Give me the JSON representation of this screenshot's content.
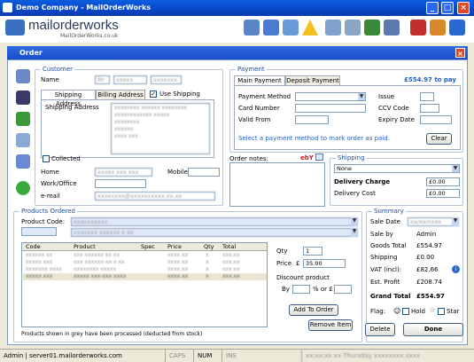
{
  "window": {
    "title": "Demo Company - MailOrderWorks"
  },
  "logo": {
    "name": "mailorderworks",
    "url": "MailOrderWorks.co.uk"
  },
  "dialog": {
    "title": "Order",
    "close": "×"
  },
  "customer": {
    "group": "Customer",
    "name_label": "Name",
    "name_title": "Mr",
    "name_first": "xxxxx",
    "name_last": "xxxxxxx",
    "tabs": [
      "Shipping Address",
      "Billing Address"
    ],
    "use_shipping": "Use Shipping",
    "shipping_label": "Shipping Address",
    "address_lines": [
      "xxxxxxxx xxxxxx xxxxxxxx",
      "xxxxxxxxxxxx xxxxx",
      "xxxxxxxx",
      "xxxxxx",
      "xxxx xxx"
    ],
    "collected": "Collected",
    "home_label": "Home",
    "home_value": "xxxxx xxx xxx",
    "mobile_label": "Mobile",
    "work_label": "Work/Office",
    "email_label": "e-mail",
    "email_value": "xxxxxxxx@xxxxxxxxxx.xx.xx"
  },
  "payment": {
    "group": "Payment",
    "tabs": [
      "Main Payment",
      "Deposit Payment"
    ],
    "amount_due": "£554.97 to pay",
    "method_label": "Payment Method",
    "card_label": "Card Number",
    "valid_label": "Valid From",
    "issue_label": "Issue",
    "ccv_label": "CCV Code",
    "expiry_label": "Expiry Date",
    "hint": "Select a payment method to mark order as paid.",
    "clear": "Clear"
  },
  "notes": {
    "label": "Order notes:",
    "ebay": "ebY"
  },
  "shipping": {
    "group": "Shipping",
    "method": "None",
    "charge_label": "Delivery Charge",
    "charge_value": "£0.00",
    "cost_label": "Delivery Cost",
    "cost_value": "£0.00"
  },
  "products": {
    "group": "Products Ordered",
    "code_label": "Product Code:",
    "search_value": "xxxxxxxxxx",
    "selected_value": "xxxxxxx xxxxxx x xx",
    "columns": [
      "Code",
      "Product",
      "Spec",
      "Price",
      "Qty",
      "Total"
    ],
    "rows": [
      [
        "xxxxxx xx",
        "xxx xxxxxx xx xx",
        "",
        "xxxx.xx",
        "x",
        "xxx.xx"
      ],
      [
        "xxxxx xxx",
        "xxx xxxxxx-xx x xx",
        "",
        "xxxx.xx",
        "x",
        "xxx.xx"
      ],
      [
        "xxxxxxx xxxx",
        "xxxxxxxx xxxxx",
        "",
        "xxxx.xx",
        "x",
        "xxx.xx"
      ],
      [
        "xxxxx xxx",
        "xxxxx xxx-xxx xxxx",
        "",
        "xxxx.xx",
        "x",
        "xxx.xx"
      ]
    ],
    "qty_label": "Qty",
    "qty_value": "1",
    "price_label": "Price",
    "currency": "£",
    "price_value": "35.00",
    "discount_label": "Discount product",
    "by_label": "By",
    "percent_or": "% or £",
    "add_button": "Add To Order",
    "remove_button": "Remove Item",
    "footnote": "Products shown in grey have been processed (deducted from stock)"
  },
  "summary": {
    "group": "Summary",
    "sale_date_label": "Sale Date",
    "sale_date_value": "xx/xx/xxxx",
    "sale_by_label": "Sale by",
    "sale_by_value": "Admin",
    "goods_label": "Goods Total",
    "goods_value": "£554.97",
    "shipping_label": "Shipping",
    "shipping_value": "£0.00",
    "vat_label": "VAT (incl):",
    "vat_value": "£82.66",
    "profit_label": "Est. Profit",
    "profit_value": "£208.74",
    "grand_label": "Grand Total",
    "grand_value": "£554.97",
    "flag_label": "Flag:",
    "hold": "Hold",
    "star": "Star"
  },
  "actions": {
    "delete": "Delete",
    "done": "Done"
  },
  "status": {
    "user": "Admin | server01.mailorderworks.com",
    "caps": "CAPS",
    "num": "NUM",
    "ins": "INS",
    "date": "xx:xx:xx xx Thursday xxxxxxxx xxxx"
  }
}
